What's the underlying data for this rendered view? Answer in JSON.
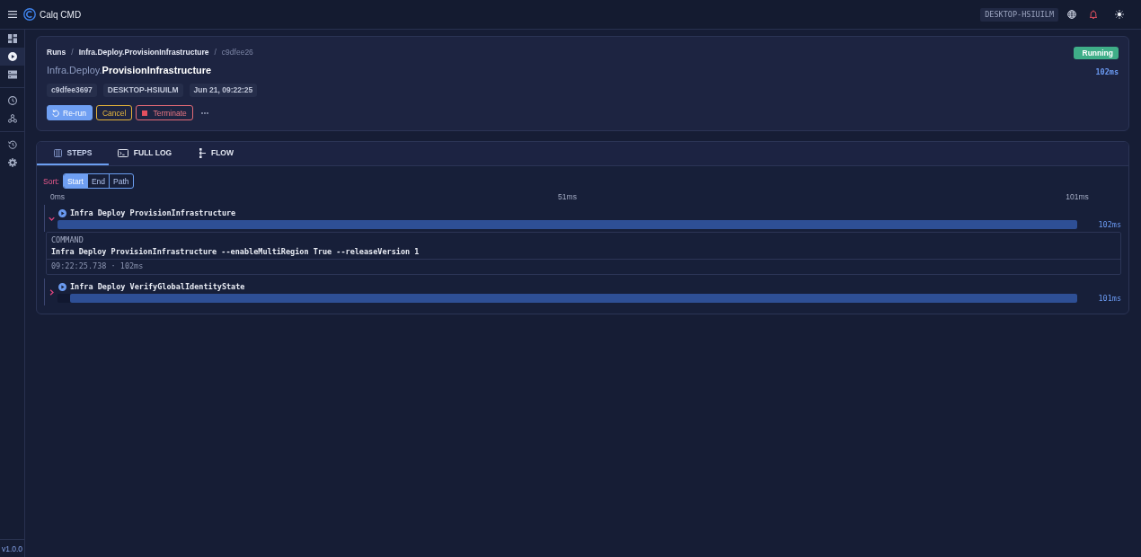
{
  "app": {
    "title": "Calq CMD",
    "host": "DESKTOP-HSIUILM"
  },
  "sidebar": {
    "groups": [
      {
        "items": [
          {
            "kind": "dashboard",
            "selected": false
          },
          {
            "kind": "play",
            "selected": true
          },
          {
            "kind": "server",
            "selected": false
          }
        ]
      },
      {
        "items": [
          {
            "kind": "clock",
            "selected": false
          },
          {
            "kind": "network",
            "selected": false
          }
        ]
      },
      {
        "items": [
          {
            "kind": "history",
            "selected": false
          },
          {
            "kind": "settings",
            "selected": false
          }
        ]
      }
    ],
    "version": "v1.0.0"
  },
  "run": {
    "breadcrumb": [
      {
        "label": "Runs",
        "current": false
      },
      {
        "separator": "/",
        "label": "Infra.Deploy.ProvisionInfrastructure",
        "current": false
      },
      {
        "separator": "/",
        "label": "c9dfee26",
        "current": true
      }
    ],
    "title": "Infra.Deploy.**ProvisionInfrastructure**",
    "status": "Running",
    "duration": "102ms",
    "chips": [
      "c9dfee3697",
      "DESKTOP-HSIUILM",
      "Jun 21, 09:22:25"
    ],
    "actions": [
      {
        "label": "Re-run",
        "kind": "primary"
      },
      {
        "label": "Cancel",
        "kind": "warning"
      },
      {
        "label": "Terminate",
        "kind": "danger"
      }
    ]
  },
  "tabs": [
    {
      "label": "STEPS",
      "kind": "steps",
      "selected": true
    },
    {
      "label": "FULL LOG",
      "kind": "log",
      "selected": false
    },
    {
      "label": "FLOW",
      "kind": "flow",
      "selected": false
    }
  ],
  "sort": {
    "label": "Sort:",
    "options": [
      {
        "label": "Start",
        "selected": true
      },
      {
        "label": "End",
        "selected": false
      },
      {
        "label": "Path",
        "selected": false
      }
    ]
  },
  "timeline": {
    "scale": [
      "0ms",
      "51ms",
      "101ms"
    ],
    "steps": [
      {
        "name": "Infra Deploy ProvisionInfrastructure",
        "expanded": true,
        "level": 1,
        "duration": "102ms",
        "command": {
          "label": "COMMAND",
          "text": "Infra Deploy ProvisionInfrastructure --enableMultiRegion True --releaseVersion 1",
          "meta": "09:22:25.738 · 102ms"
        }
      },
      {
        "name": "Infra Deploy VerifyGlobalIdentityState",
        "expanded": false,
        "level": 0.988,
        "duration": "101ms"
      }
    ]
  }
}
